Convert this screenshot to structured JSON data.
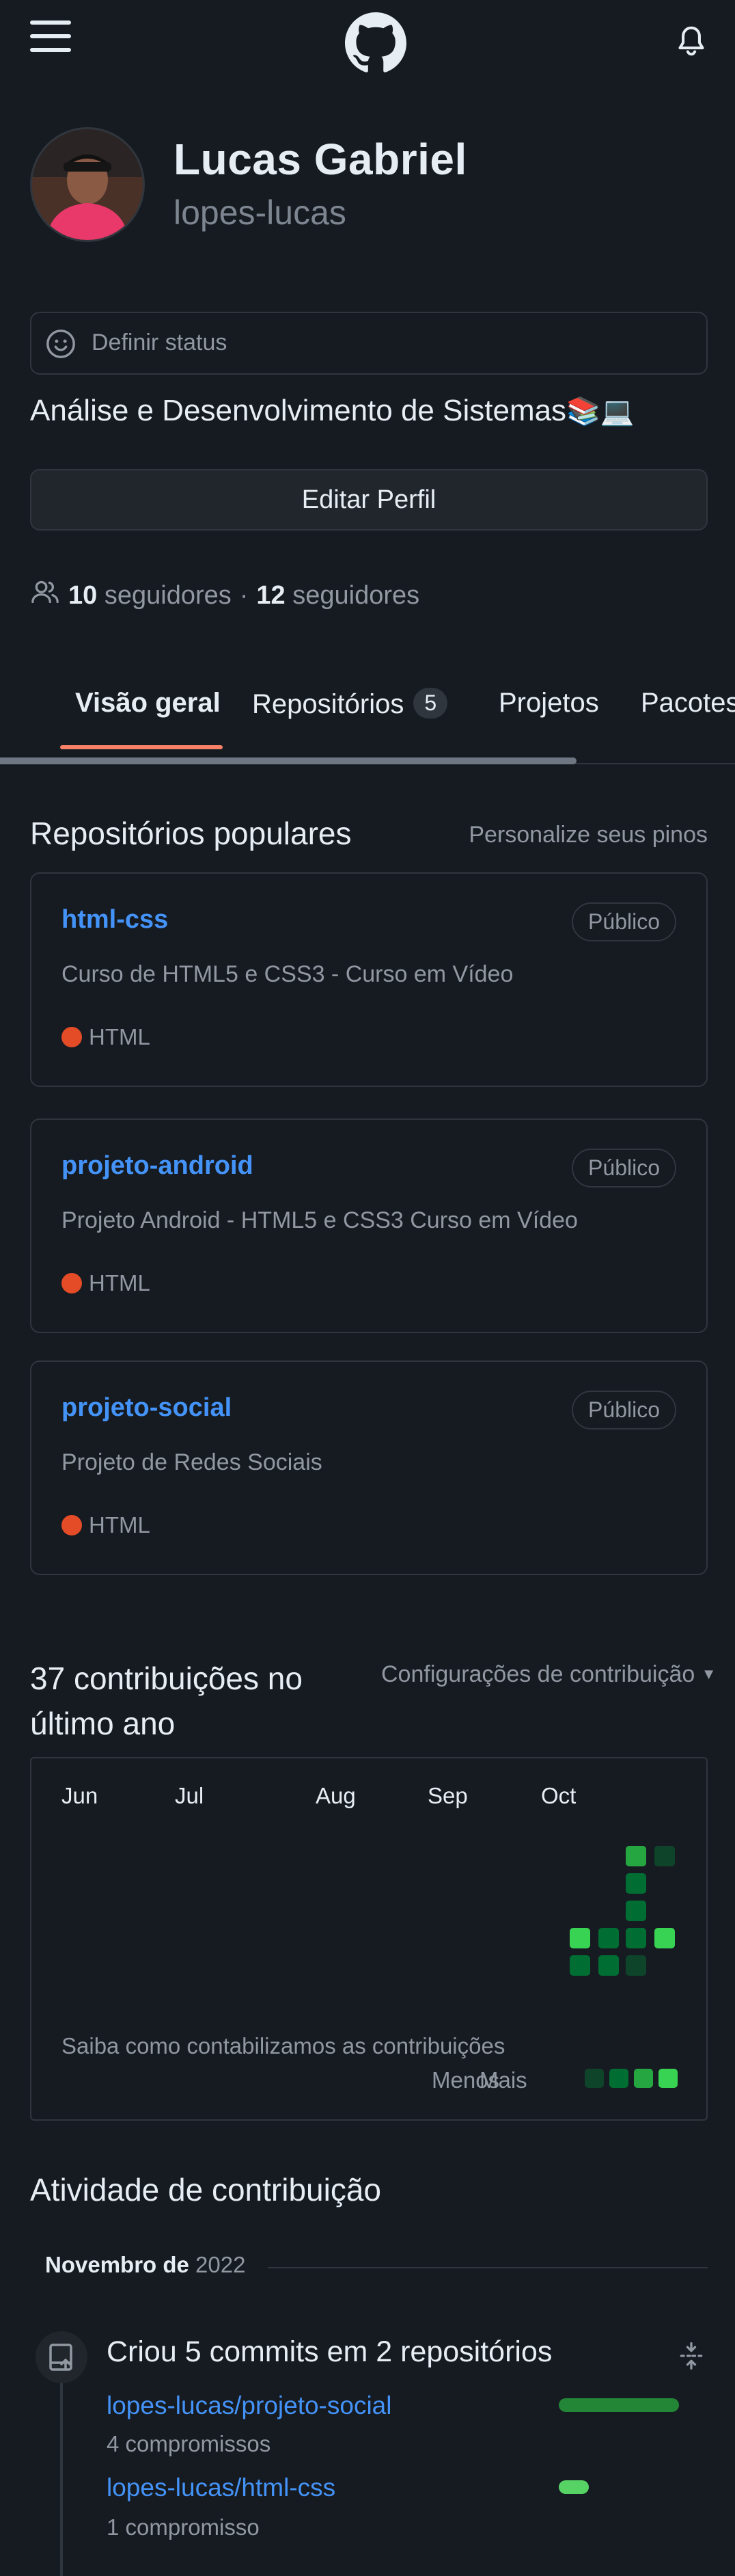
{
  "header": {
    "menu_icon": "hamburger-menu-icon",
    "logo_icon": "github-octocat-icon",
    "notifications_icon": "bell-icon"
  },
  "profile": {
    "name": "Lucas Gabriel",
    "login": "lopes-lucas",
    "status_placeholder": "Definir status",
    "bio": "Análise e Desenvolvimento de Sistemas",
    "bio_emoji": "📚💻",
    "edit_button": "Editar Perfil",
    "followers_count": "10",
    "followers_label": "seguidores",
    "separator": "·",
    "following_count": "12",
    "following_label": "seguidores"
  },
  "tabs": [
    {
      "label": "Visão geral",
      "active": true
    },
    {
      "label": "Repositórios",
      "count": "5"
    },
    {
      "label": "Projetos"
    },
    {
      "label": "Pacotes"
    }
  ],
  "popular": {
    "title": "Repositórios populares",
    "customize_link": "Personalize seus pinos",
    "repos": [
      {
        "name": "html-css",
        "visibility": "Público",
        "description": "Curso de HTML5 e CSS3 - Curso em Vídeo",
        "language": "HTML"
      },
      {
        "name": "projeto-android",
        "visibility": "Público",
        "description": "Projeto Android - HTML5 e CSS3 Curso em Vídeo",
        "language": "HTML"
      },
      {
        "name": "projeto-social",
        "visibility": "Público",
        "description": "Projeto de Redes Sociais",
        "language": "HTML"
      }
    ]
  },
  "contributions": {
    "title_line1": "37 contribuições no",
    "title_line2": "último ano",
    "settings_link": "Configurações de contribuição",
    "months": [
      "Jun",
      "Jul",
      "Aug",
      "Sep",
      "Oct"
    ],
    "learn_link": "Saiba como contabilizamos as contribuições",
    "legend_less": "Menos",
    "legend_more": "Mais",
    "colors": {
      "level1": "#0e4429",
      "level2": "#006d32",
      "level3": "#26a641",
      "level4": "#39d353"
    }
  },
  "activity": {
    "title": "Atividade de contribuição",
    "month": "Novembro de",
    "year": "2022",
    "summary": "Criou 5 commits em 2 repositórios",
    "items": [
      {
        "repo": "lopes-lucas/projeto-social",
        "commits": "4 compromissos",
        "share": 0.8
      },
      {
        "repo": "lopes-lucas/html-css",
        "commits": "1 compromisso",
        "share": 0.2
      }
    ]
  }
}
